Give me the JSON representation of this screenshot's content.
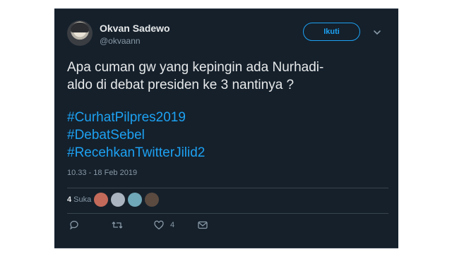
{
  "author": {
    "name": "Okvan Sadewo",
    "handle": "@okvaann"
  },
  "follow_button": {
    "label": "Ikuti"
  },
  "tweet": {
    "text_line1": "Apa cuman gw yang kepingin ada Nurhadi-",
    "text_line2": "aldo di debat presiden ke 3 nantinya ?",
    "hashtags": [
      "#CurhatPilpres2019",
      "#DebatSebel",
      "#RecehkanTwitterJilid2"
    ],
    "timestamp": "10.33 - 18 Feb 2019"
  },
  "engagement": {
    "likes_count": "4",
    "likes_label": "Suka",
    "likers": [
      {
        "name": "liker-avatar",
        "color": "#c46a5a"
      },
      {
        "name": "liker-avatar",
        "color": "#aab4c0"
      },
      {
        "name": "liker-avatar",
        "color": "#6fa8b8"
      },
      {
        "name": "liker-avatar",
        "color": "#5a4a40"
      }
    ]
  },
  "actions": {
    "reply_icon": "reply-icon",
    "retweet_icon": "retweet-icon",
    "like_icon": "heart-icon",
    "like_count": "4",
    "dm_icon": "envelope-icon"
  },
  "colors": {
    "background": "#15202b",
    "accent": "#1da1f2",
    "text": "#e7e9ea",
    "muted": "#8899a6"
  }
}
